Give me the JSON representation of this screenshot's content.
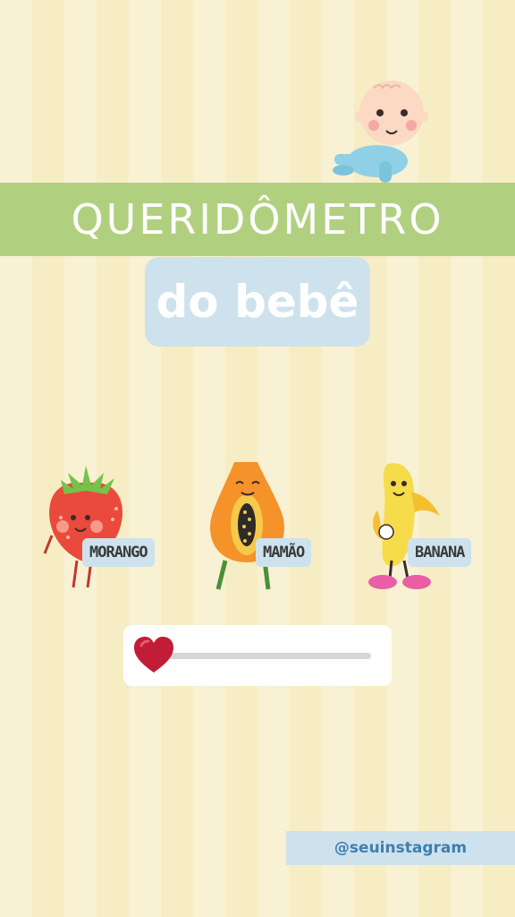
{
  "header": {
    "title": "QUERIDÔMETRO",
    "subtitle": "do bebê"
  },
  "fruits": [
    {
      "name": "MORANGO",
      "icon": "strawberry-character-icon"
    },
    {
      "name": "MAMÃO",
      "icon": "papaya-character-icon"
    },
    {
      "name": "BANANA",
      "icon": "banana-character-icon"
    }
  ],
  "slider": {
    "icon": "heart-icon",
    "value_percent": 0
  },
  "footer": {
    "handle": "@seuinstagram"
  },
  "colors": {
    "banner_green": "#b1d07f",
    "label_blue": "#cde2ed",
    "heart_red": "#c11d36",
    "handle_blue": "#3f7fb0"
  }
}
